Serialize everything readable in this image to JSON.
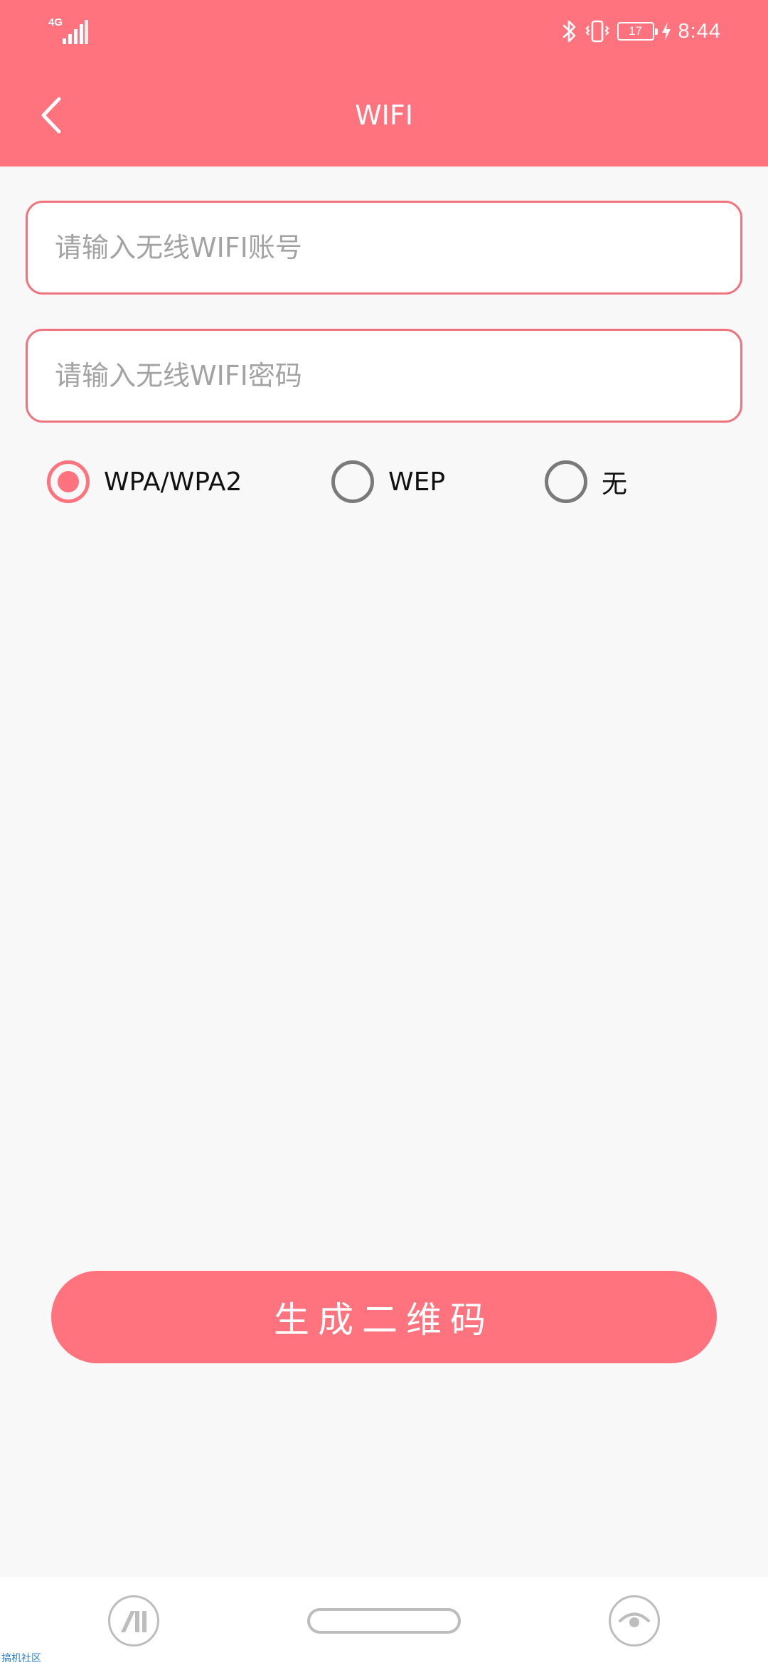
{
  "status_bar": {
    "network": "4G",
    "battery": "17",
    "time": "8:44"
  },
  "header": {
    "title": "WIFI"
  },
  "form": {
    "account_placeholder": "请输入无线WIFI账号",
    "account_value": "",
    "password_placeholder": "请输入无线WIFI密码",
    "password_value": ""
  },
  "encryption": {
    "options": [
      {
        "label": "WPA/WPA2",
        "checked": true
      },
      {
        "label": "WEP",
        "checked": false
      },
      {
        "label": "无",
        "checked": false
      }
    ]
  },
  "actions": {
    "generate_label": "生成二维码"
  },
  "watermark": "搞机社区",
  "colors": {
    "accent": "#ff737e",
    "field_border": "#ee7480",
    "radio_unchecked": "#7a7a7a",
    "background": "#f8f8f8"
  }
}
